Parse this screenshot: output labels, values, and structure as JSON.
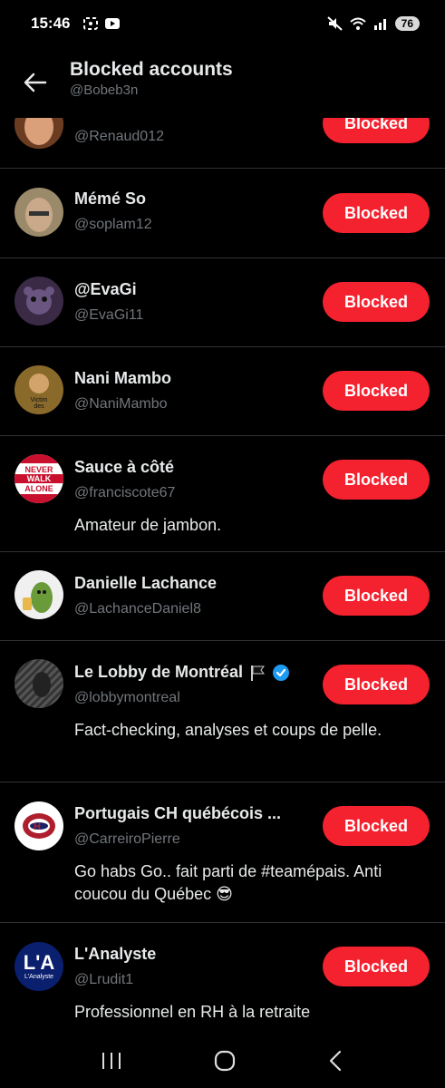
{
  "status": {
    "time": "15:46",
    "battery": "76"
  },
  "header": {
    "title": "Blocked accounts",
    "subtitle": "@Bobeb3n"
  },
  "accounts": [
    {
      "name": "",
      "handle": "@Renaud012",
      "bio": "",
      "button": "Blocked",
      "avatar_color": "#7a4a2a"
    },
    {
      "name": "Mémé So",
      "handle": "@soplam12",
      "bio": "",
      "button": "Blocked",
      "avatar_color": "#8a7a60"
    },
    {
      "name": "@EvaGi",
      "handle": "@EvaGi11",
      "bio": "",
      "button": "Blocked",
      "avatar_color": "#4a3a55"
    },
    {
      "name": "Nani Mambo",
      "handle": "@NaniMambo",
      "bio": "",
      "button": "Blocked",
      "avatar_color": "#8a6a2a",
      "avatar_text": "Victim des boomers"
    },
    {
      "name": "Sauce à côté",
      "handle": "@franciscote67",
      "bio": "Amateur de jambon.",
      "button": "Blocked",
      "avatar_color": "#c8102e",
      "avatar_text": "NEVER WALK ALONE"
    },
    {
      "name": "Danielle Lachance",
      "handle": "@LachanceDaniel8",
      "bio": "",
      "button": "Blocked",
      "avatar_color": "#f0f0f0"
    },
    {
      "name": "Le Lobby de Montréal",
      "handle": "@lobbymontreal",
      "bio": "Fact-checking, analyses et coups de pelle.",
      "button": "Blocked",
      "avatar_color": "#444"
    },
    {
      "name": "Portugais CH québécois ...",
      "handle": "@CarreiroPierre",
      "bio": "Go habs Go.. fait parti de #teamépais. Anti coucou du Québec 😎",
      "button": "Blocked",
      "avatar_color": "#ffffff"
    },
    {
      "name": "L'Analyste",
      "handle": "@Lrudit1",
      "bio": "Professionnel en RH à la retraite",
      "button": "Blocked",
      "avatar_color": "#0a1f6e",
      "avatar_text": "L'A",
      "avatar_subtext": "L'Analyste"
    }
  ],
  "colors": {
    "accent": "#f4212e",
    "verified": "#1d9bf0",
    "muted": "#71767b"
  }
}
